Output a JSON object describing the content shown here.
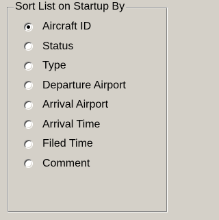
{
  "group": {
    "title": "Sort List on Startup By"
  },
  "options": [
    {
      "label": "Aircraft ID",
      "selected": true
    },
    {
      "label": "Status",
      "selected": false
    },
    {
      "label": "Type",
      "selected": false
    },
    {
      "label": "Departure Airport",
      "selected": false
    },
    {
      "label": "Arrival Airport",
      "selected": false
    },
    {
      "label": "Arrival Time",
      "selected": false
    },
    {
      "label": "Filed Time",
      "selected": false
    },
    {
      "label": "Comment",
      "selected": false
    }
  ],
  "colors": {
    "background": "#d4d0c8",
    "text": "#000000"
  }
}
